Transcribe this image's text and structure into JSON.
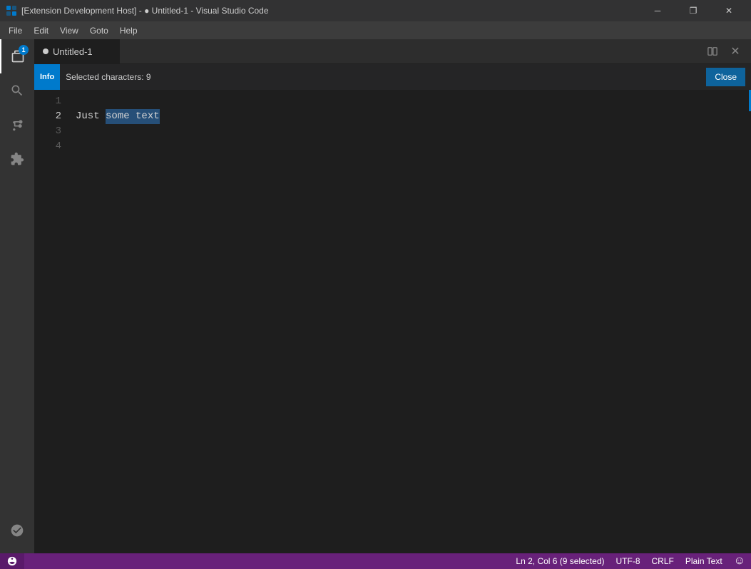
{
  "titleBar": {
    "title": "[Extension Development Host] - ● Untitled-1 - Visual Studio Code",
    "minimizeLabel": "─",
    "restoreLabel": "❐",
    "closeLabel": "✕"
  },
  "menuBar": {
    "items": [
      "File",
      "Edit",
      "View",
      "Goto",
      "Help"
    ]
  },
  "activityBar": {
    "items": [
      {
        "name": "explorer",
        "badge": "1"
      },
      {
        "name": "search",
        "badge": null
      },
      {
        "name": "source-control",
        "badge": null
      },
      {
        "name": "extensions",
        "badge": null
      }
    ],
    "bottomItems": [
      {
        "name": "account"
      }
    ]
  },
  "tabs": [
    {
      "label": "Untitled-1",
      "modified": true,
      "active": true
    }
  ],
  "notification": {
    "badge": "Info",
    "message": "Selected characters: 9",
    "closeLabel": "Close"
  },
  "editor": {
    "lines": [
      {
        "num": "1",
        "content": "",
        "hasSelection": false
      },
      {
        "num": "2",
        "content": "Just some text",
        "hasSelection": true,
        "selectedStart": 5,
        "selectedText": "some text"
      },
      {
        "num": "3",
        "content": "",
        "hasSelection": false
      },
      {
        "num": "4",
        "content": "",
        "hasSelection": false
      }
    ]
  },
  "statusBar": {
    "remote": "⚡",
    "position": "Ln 2, Col 6 (9 selected)",
    "encoding": "UTF-8",
    "lineEnding": "CRLF",
    "language": "Plain Text",
    "feedbackLabel": "☺"
  }
}
